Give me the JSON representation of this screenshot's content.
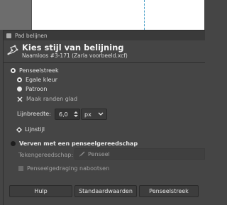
{
  "dialog": {
    "title": "Pad belijnen",
    "header_title": "Kies stijl van belijning",
    "header_subtitle": "Naamloos #3-171 (Zarla voorbeeld.xcf)"
  },
  "stroke_line": {
    "section_label": "Penseelstreek",
    "solid_color_label": "Egale kleur",
    "pattern_label": "Patroon",
    "antialias_label": "Maak randen glad",
    "line_width_label": "Lijnbreedte:",
    "line_width_value": "6,0",
    "unit_value": "px",
    "line_style_label": "Lijnstijl"
  },
  "paint_tool": {
    "section_label": "Verven met een penseelgereedschap",
    "tool_label": "Tekengereedschap:",
    "tool_value": "Penseel",
    "emulate_label": "Penseelgedraging nabootsen"
  },
  "buttons": {
    "help": "Hulp",
    "reset": "Standaardwaarden",
    "stroke": "Penseelstreek"
  }
}
